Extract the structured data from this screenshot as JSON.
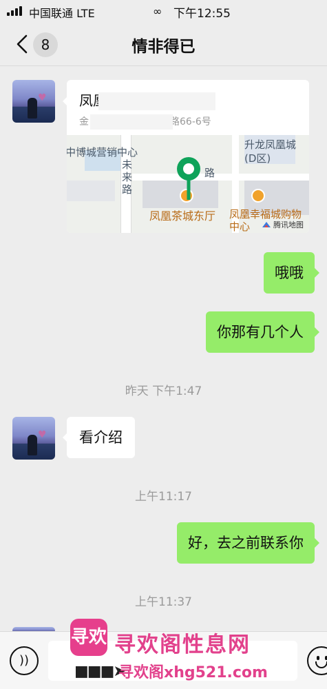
{
  "status_bar": {
    "carrier": "中国联通  LTE",
    "time": "下午12:55"
  },
  "nav": {
    "unread_count": "8",
    "title": "情非得已"
  },
  "location_message": {
    "title": "凤凰",
    "subtitle": "金",
    "subtitle_tail": "路66-6号",
    "map_labels": {
      "center_left": "中博城营销中心",
      "top_right": "升龙凤凰城(D区)",
      "road_vertical": "未来路",
      "road_horizontal": "路",
      "poi_main": "凤凰茶城东厅",
      "poi_right": "凤凰幸福城购物中心",
      "provider": "腾讯地图"
    }
  },
  "messages": [
    {
      "side": "right",
      "text": "哦哦"
    },
    {
      "side": "right",
      "text": "你那有几个人"
    },
    {
      "type": "time",
      "text": "昨天 下午1:47"
    },
    {
      "side": "left",
      "text": "看介绍"
    },
    {
      "type": "time",
      "text": "上午11:17"
    },
    {
      "side": "right",
      "text": "好，去之前联系你"
    },
    {
      "type": "time",
      "text": "上午11:37"
    }
  ],
  "watermark": {
    "logo_text": "寻欢",
    "site_name": "寻欢阁性息网",
    "url": "寻欢阁xhg521.com"
  },
  "colors": {
    "sent_bubble": "#95ec69",
    "received_bubble": "#ffffff",
    "background": "#ededed",
    "map_pin": "#0fa35a"
  },
  "icons": {
    "back": "chevron-left-icon",
    "voice": "voice-icon",
    "emoji": "emoji-icon",
    "location": "map-pin-icon",
    "link": "link-icon"
  }
}
